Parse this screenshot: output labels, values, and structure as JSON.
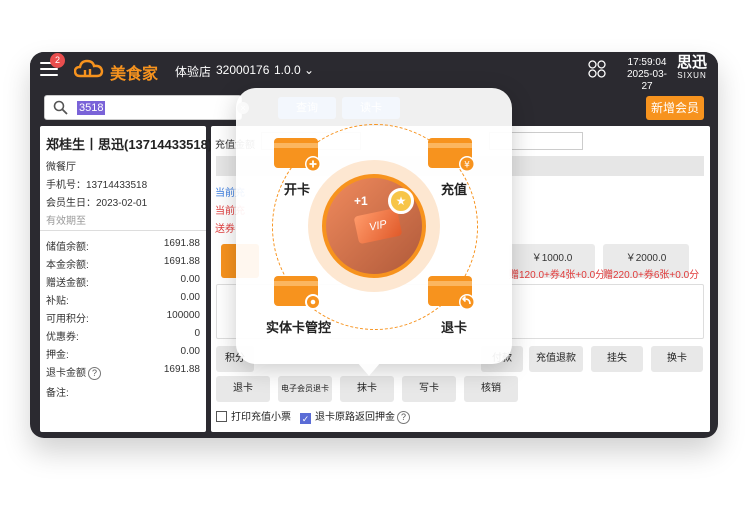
{
  "colors": {
    "accent": "#f7931e",
    "primary_blue": "#5b8de0",
    "danger": "#e03b3b",
    "device_bg": "#2b2a30"
  },
  "topbar": {
    "badge_count": "2",
    "brand": "美食家",
    "store": "体验店",
    "store_id": "32000176",
    "version": "1.0.0",
    "time": "17:59:04",
    "date": "2025-03-27",
    "corner_brand_cn": "思迅",
    "corner_brand_en": "SIXUN"
  },
  "search": {
    "value": "3518",
    "query_label": "查询",
    "read_label": "读卡",
    "new_member_label": "新增会员"
  },
  "member": {
    "name": "郑桂生丨思迅(13714433518)",
    "level": "微餐厅",
    "phone": "手机号：13714433518",
    "birthday": "会员生日：2023-02-01",
    "validity": "有效期至",
    "fields": [
      {
        "label": "储值余额:",
        "value": "1691.88"
      },
      {
        "label": "本金余额:",
        "value": "1691.88"
      },
      {
        "label": "赠送金额:",
        "value": "0.00"
      },
      {
        "label": "补贴:",
        "value": "0.00"
      },
      {
        "label": "可用积分:",
        "value": "100000"
      },
      {
        "label": "优惠券:",
        "value": "0"
      },
      {
        "label": "押金:",
        "value": "0.00"
      },
      {
        "label": "退卡金额",
        "value": "1691.88"
      },
      {
        "label": "备注:",
        "value": ""
      }
    ]
  },
  "recharge": {
    "amount_label": "充值金额",
    "blue_text": "当前充",
    "red_text": "当前充",
    "gift_text": "送券",
    "amounts": [
      {
        "a": "￥1000.0",
        "b": "赠120.0+券4张+0.0分"
      },
      {
        "a": "￥2000.0",
        "b": "赠220.0+券6张+0.0分"
      }
    ],
    "actions_row1": [
      "积分",
      "",
      "",
      "",
      "付款",
      "充值退款",
      "挂失",
      "换卡"
    ],
    "actions_row2": [
      "退卡",
      "电子会员退卡",
      "抹卡",
      "写卡",
      "核销"
    ],
    "print_receipt": "打印充值小票",
    "refund_original": "退卡原路返回押金"
  },
  "quick_actions": {
    "open_card": "开卡",
    "recharge": "充值",
    "physical_card": "实体卡管控",
    "return_card": "退卡",
    "center_card_text": "VIP",
    "center_plus": "+1"
  }
}
